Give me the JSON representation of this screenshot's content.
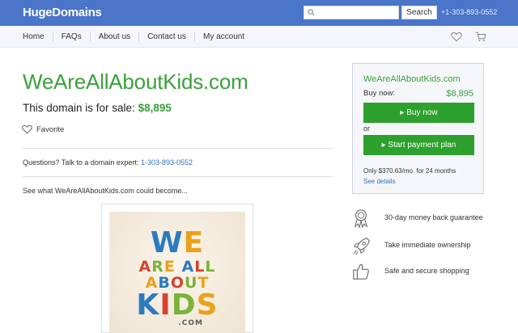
{
  "header": {
    "logo": "HugeDomains",
    "search_placeholder": "",
    "search_button": "Search",
    "phone": "+1-303-893-0552"
  },
  "nav": {
    "items": [
      "Home",
      "FAQs",
      "About us",
      "Contact us",
      "My account"
    ]
  },
  "main": {
    "domain": "WeAreAllAboutKids.com",
    "for_sale_text": "This domain is for sale:",
    "price": "$8,895",
    "favorite": "Favorite",
    "questions_text": "Questions? Talk to a domain expert:",
    "questions_phone": "1-303-893-0552",
    "see_what": "See what WeAreAllAboutKids.com could become...",
    "logo_lines": [
      "WE",
      "ARE ALL",
      "ABOUT",
      "KIDS",
      ".COM"
    ]
  },
  "buybox": {
    "domain": "WeAreAllAboutKids.com",
    "buy_now_label": "Buy now:",
    "price": "$8,895",
    "buy_button": "▸ Buy now",
    "or": "or",
    "plan_button": "▸ Start payment plan",
    "only_text": "Only $370.63/mo. for 24 months",
    "see_details": "See details"
  },
  "features": [
    {
      "label": "30-day money back guarantee",
      "icon": "ribbon-icon"
    },
    {
      "label": "Take immediate ownership",
      "icon": "rocket-icon"
    },
    {
      "label": "Safe and secure shopping",
      "icon": "thumbs-up-icon"
    }
  ],
  "colors": {
    "header_bg": "#4a75c8",
    "accent_green": "#3aa13a",
    "button_green": "#2da02d",
    "link_blue": "#2f6fbf"
  }
}
